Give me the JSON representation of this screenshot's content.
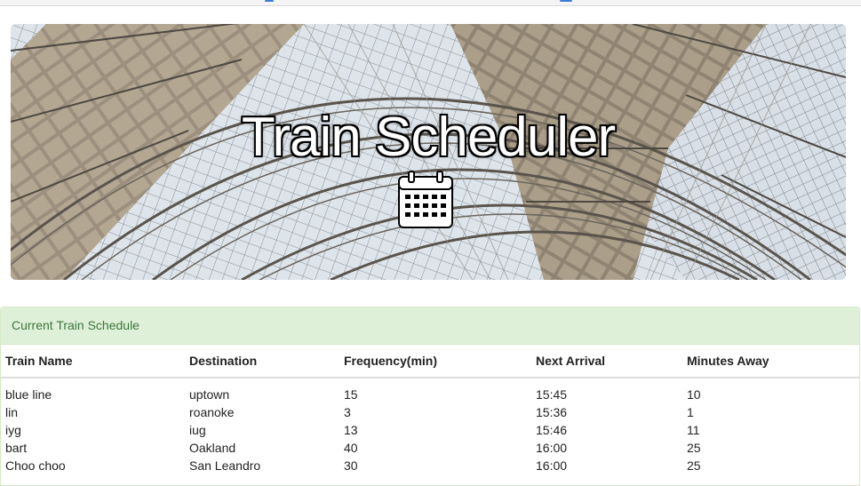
{
  "hero": {
    "title": "Train Scheduler",
    "icon": "calendar-icon",
    "background": "train-station-roof-image"
  },
  "panel": {
    "heading": "Current Train Schedule",
    "heading_color": "#3c763d",
    "heading_bg": "#dff0d8"
  },
  "table": {
    "headers": [
      "Train Name",
      "Destination",
      "Frequency(min)",
      "Next Arrival",
      "Minutes Away"
    ],
    "rows": [
      [
        "blue line",
        "uptown",
        "15",
        "15:45",
        "10"
      ],
      [
        "lin",
        "roanoke",
        "3",
        "15:36",
        "1"
      ],
      [
        "iyg",
        "iug",
        "13",
        "15:46",
        "11"
      ],
      [
        "bart",
        "Oakland",
        "40",
        "16:00",
        "25"
      ],
      [
        "Choo choo",
        "San Leandro",
        "30",
        "16:00",
        "25"
      ]
    ]
  }
}
